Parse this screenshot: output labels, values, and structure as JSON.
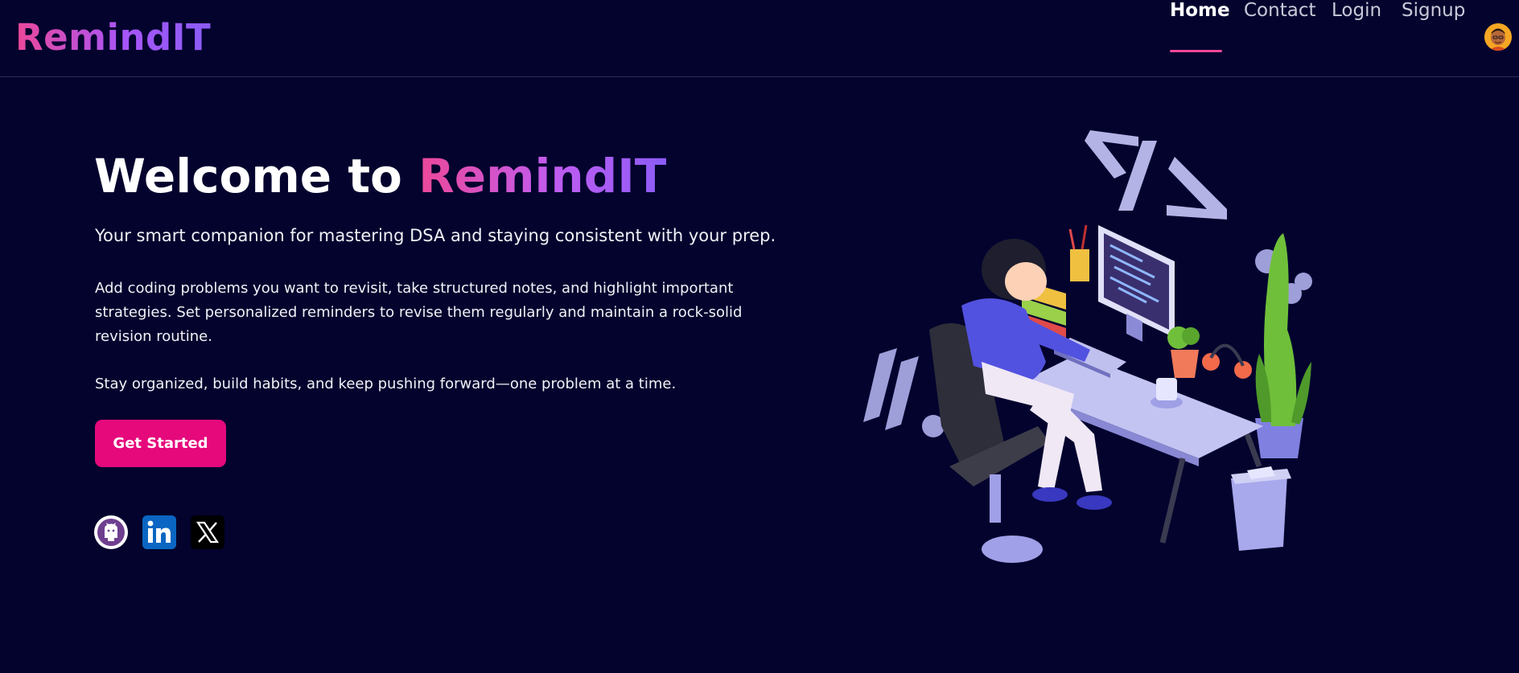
{
  "header": {
    "logo_text": "RemindIT",
    "nav": [
      {
        "label": "Home",
        "active": true
      },
      {
        "label": "Contact",
        "active": false
      },
      {
        "label": "Login",
        "active": false
      },
      {
        "label": "Signup",
        "active": false
      }
    ]
  },
  "hero": {
    "title_prefix": "Welcome to ",
    "title_brand": "RemindIT",
    "subtitle": "Your smart companion for mastering DSA and staying consistent with your prep.",
    "paragraph1": "Add coding problems you want to revisit, take structured notes, and highlight important strategies. Set personalized reminders to revise them regularly and maintain a rock-solid revision routine.",
    "paragraph2": "Stay organized, build habits, and keep pushing forward—one problem at a time.",
    "cta_label": "Get Started"
  },
  "social": [
    {
      "name": "github-icon"
    },
    {
      "name": "linkedin-icon"
    },
    {
      "name": "x-icon"
    }
  ],
  "colors": {
    "background": "#03032e",
    "accent_pink": "#ec4899",
    "accent_purple": "#8b5cf6",
    "cta": "#e5097c"
  }
}
